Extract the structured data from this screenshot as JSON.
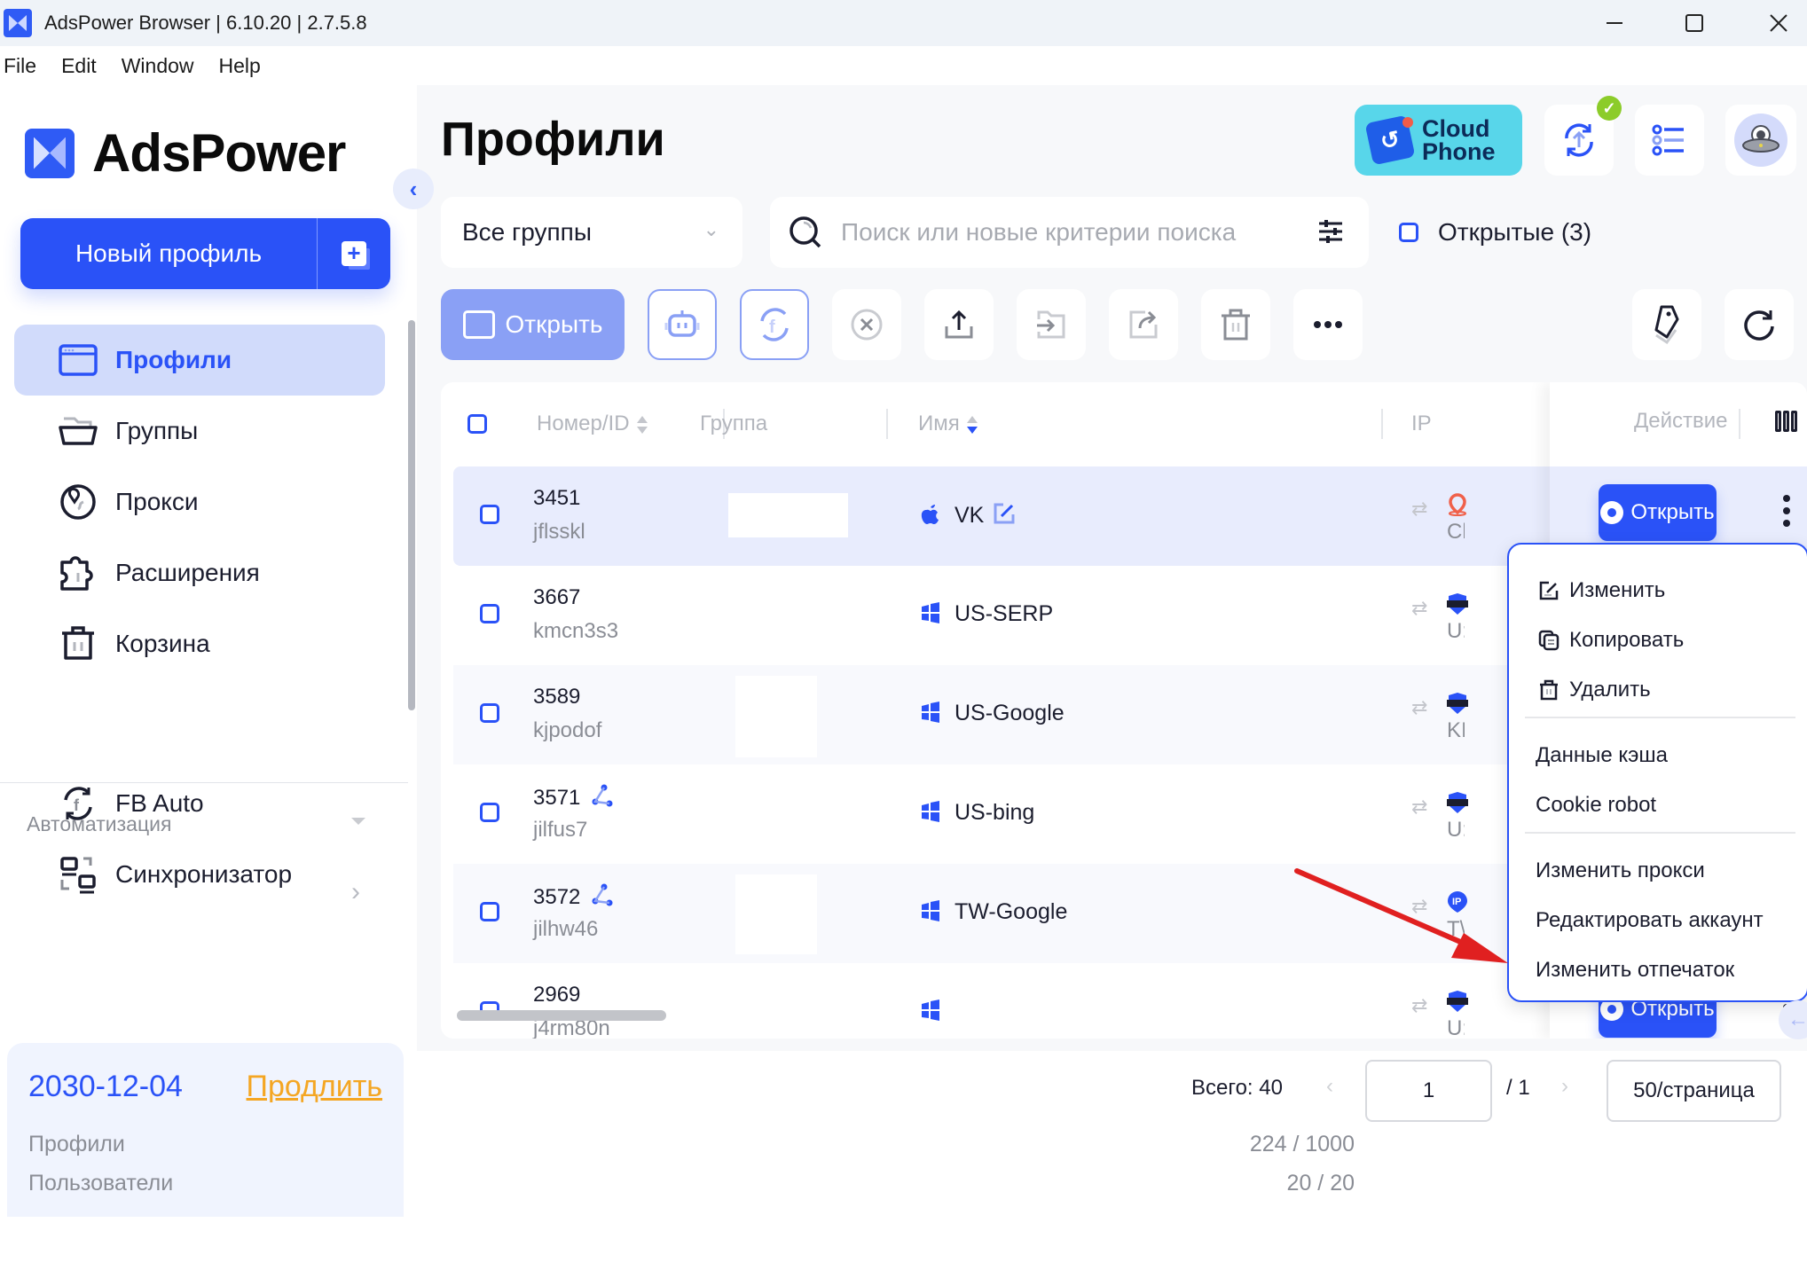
{
  "window": {
    "title": "AdsPower Browser | 6.10.20 | 2.7.5.8",
    "controls": {
      "minimize": "—",
      "maximize": "☐",
      "close": "✕"
    }
  },
  "menubar": [
    "File",
    "Edit",
    "Window",
    "Help"
  ],
  "sidebar": {
    "logo_text": "AdsPower",
    "new_profile_label": "Новый профиль",
    "nav": [
      {
        "label": "Профили",
        "icon": "browser-window-icon",
        "active": true
      },
      {
        "label": "Группы",
        "icon": "folder-icon"
      },
      {
        "label": "Прокси",
        "icon": "globe-pin-icon"
      },
      {
        "label": "Расширения",
        "icon": "puzzle-icon"
      },
      {
        "label": "Корзина",
        "icon": "trash-icon"
      }
    ],
    "automation_label": "Автоматизация",
    "automation_items": [
      {
        "label": "FB Auto",
        "icon": "facebook-sync-icon",
        "has_submenu": true
      },
      {
        "label": "Синхронизатор",
        "icon": "synchronizer-icon"
      }
    ],
    "plan": {
      "expiry": "2030-12-04",
      "renew_label": "Продлить",
      "profiles_label": "Профили",
      "profiles_value": "224 / 1000",
      "users_label": "Пользователи",
      "users_value": "20 / 20"
    }
  },
  "header": {
    "page_title": "Профили",
    "cloud_phone_line1": "Cloud",
    "cloud_phone_line2": "Phone"
  },
  "filters": {
    "group_select": "Все группы",
    "search_placeholder": "Поиск или новые критерии поиска",
    "opened_label": "Открытые (3)"
  },
  "toolbar": {
    "open_label": "Открыть",
    "icons": [
      "robot-icon",
      "facebook-sync-icon",
      "close-circle-icon",
      "upload-icon",
      "move-to-group-icon",
      "share-icon",
      "trash-icon",
      "more-icon",
      "tag-icon",
      "refresh-icon"
    ]
  },
  "table": {
    "columns": {
      "id": "Номер/ID",
      "group": "Группа",
      "name": "Имя",
      "ip": "IP",
      "action": "Действие"
    },
    "open_label": "Открыть",
    "rows": [
      {
        "id": "3451",
        "uid": "jflsskl",
        "os": "apple",
        "name": "VK",
        "shared": false,
        "proxy_icon": "location",
        "proxy_text": "Cl",
        "selected": true
      },
      {
        "id": "3667",
        "uid": "kmcn3s3",
        "os": "windows",
        "name": "US-SERP",
        "shared": false,
        "proxy_icon": "socks",
        "proxy_text": "U:"
      },
      {
        "id": "3589",
        "uid": "kjpodof",
        "os": "windows",
        "name": "US-Google",
        "shared": false,
        "proxy_icon": "socks",
        "proxy_text": "KI"
      },
      {
        "id": "3571",
        "uid": "jilfus7",
        "os": "windows",
        "name": "US-bing",
        "shared": true,
        "proxy_icon": "socks",
        "proxy_text": "U:"
      },
      {
        "id": "3572",
        "uid": "jilhw46",
        "os": "windows",
        "name": "TW-Google",
        "shared": true,
        "proxy_icon": "ip",
        "proxy_text": "T\\"
      },
      {
        "id": "2969",
        "uid": "j4rm80n",
        "os": "windows",
        "name": "",
        "shared": false,
        "proxy_icon": "socks",
        "proxy_text": "U:"
      }
    ]
  },
  "context_menu": {
    "items": [
      {
        "label": "Изменить",
        "icon": "edit-icon"
      },
      {
        "label": "Копировать",
        "icon": "copy-icon"
      },
      {
        "label": "Удалить",
        "icon": "trash-icon"
      },
      {
        "label": "Данные кэша"
      },
      {
        "label": "Cookie robot"
      },
      {
        "label": "Изменить прокси"
      },
      {
        "label": "Редактировать аккаунт"
      },
      {
        "label": "Изменить отпечаток"
      }
    ]
  },
  "pagination": {
    "total": "Всего: 40",
    "current_page": "1",
    "of_pages": "/ 1",
    "per_page": "50/страница"
  },
  "colors": {
    "accent": "#2a52f7",
    "renew": "#f4a623",
    "annotation_arrow": "#e02020"
  }
}
